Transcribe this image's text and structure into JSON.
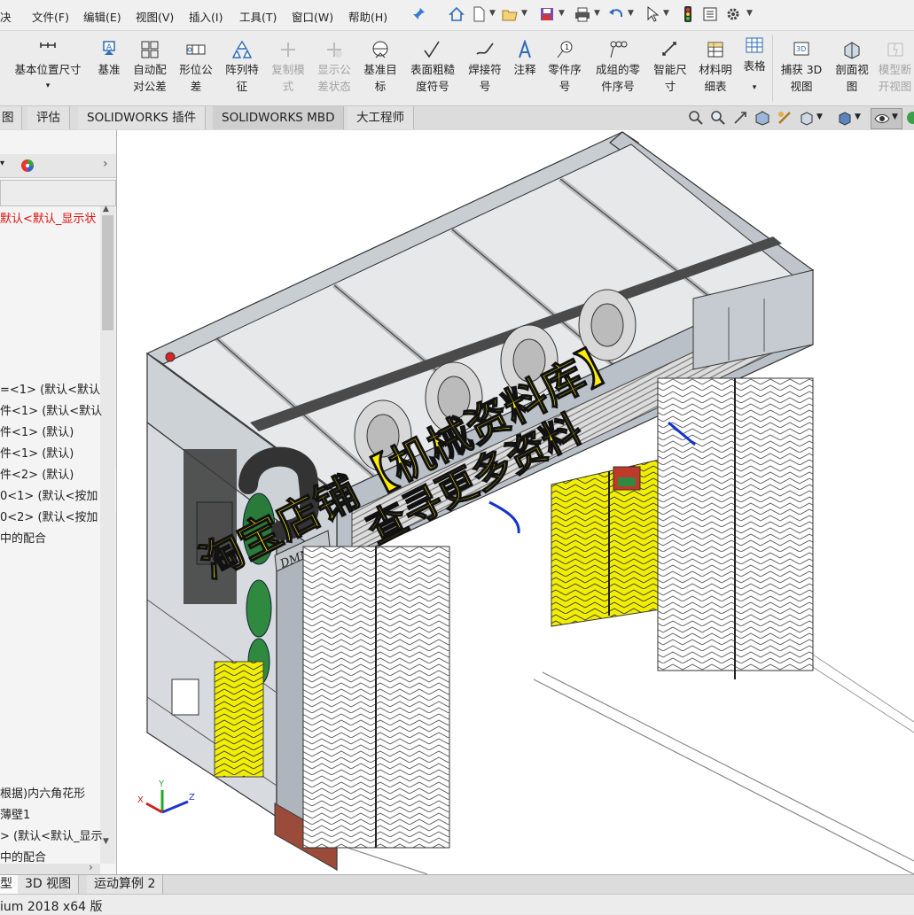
{
  "menu": {
    "items": [
      "文件(F)",
      "编辑(E)",
      "视图(V)",
      "插入(I)",
      "工具(T)",
      "窗口(W)",
      "帮助(H)"
    ],
    "left_cut": "决"
  },
  "ribbon": {
    "buttons": [
      {
        "label": "基本位置尺寸",
        "icon": "ordinate-dimension-icon"
      },
      {
        "label": "基准",
        "icon": "datum-icon"
      },
      {
        "label": "自动配\n对公差",
        "icon": "auto-tolerance-icon"
      },
      {
        "label": "形位公\n差",
        "icon": "geometric-tolerance-icon"
      },
      {
        "label": "阵列特\n征",
        "icon": "pattern-feature-icon"
      },
      {
        "label": "复制模\n式",
        "icon": "copy-scheme-icon",
        "disabled": true
      },
      {
        "label": "显示公\n差状态",
        "icon": "show-tolerance-status-icon",
        "disabled": true
      },
      {
        "label": "基准目\n标",
        "icon": "datum-target-icon"
      },
      {
        "label": "表面粗糙\n度符号",
        "icon": "surface-finish-icon"
      },
      {
        "label": "焊接符\n号",
        "icon": "weld-symbol-icon"
      },
      {
        "label": "注释",
        "icon": "note-icon"
      },
      {
        "label": "零件序\n号",
        "icon": "balloon-icon"
      },
      {
        "label": "成组的零\n件序号",
        "icon": "stacked-balloon-icon"
      },
      {
        "label": "智能尺\n寸",
        "icon": "smart-dimension-icon"
      },
      {
        "label": "材料明\n细表",
        "icon": "bom-icon"
      },
      {
        "label": "表格",
        "icon": "table-icon"
      },
      {
        "label": "捕获 3D\n视图",
        "icon": "capture-3d-view-icon"
      },
      {
        "label": "剖面视\n图",
        "icon": "section-view-icon"
      },
      {
        "label": "模型断\n开视图",
        "icon": "broken-view-icon",
        "disabled": true
      }
    ]
  },
  "tabs": {
    "items": [
      "图",
      "评估",
      "SOLIDWORKS 插件",
      "SOLIDWORKS MBD",
      "大工程师"
    ],
    "active": 3
  },
  "tree": {
    "lines": [
      {
        "text": "默认<默认_显示状",
        "red": true
      },
      {
        "text": "=<1> (默认<默认",
        "red": false
      },
      {
        "text": "件<1> (默认<默认",
        "red": false
      },
      {
        "text": "件<1> (默认)",
        "red": false
      },
      {
        "text": "件<1> (默认)",
        "red": false
      },
      {
        "text": "件<2> (默认)",
        "red": false
      },
      {
        "text": "0<1> (默认<按加",
        "red": false
      },
      {
        "text": "0<2> (默认<按加",
        "red": false
      },
      {
        "text": " 中的配合",
        "red": false
      },
      {
        "text": "根据)内六角花形",
        "red": false
      },
      {
        "text": "薄壁1",
        "red": false
      },
      {
        "text": "> (默认<默认_显示",
        "red": false
      },
      {
        "text": " 中的配合",
        "red": false
      }
    ]
  },
  "watermark": {
    "line1": "淘宝店铺【机械资料库】",
    "line2": "查寻更多资料"
  },
  "model": {
    "logo_text": "DMM"
  },
  "triad": {
    "x": "X",
    "y": "Y",
    "z": "Z"
  },
  "bottom_tabs": {
    "items": [
      "型",
      "3D 视图",
      "运动算例 2"
    ],
    "active": 0
  },
  "status": {
    "text": "ium 2018 x64 版"
  },
  "colors": {
    "frame": "#9aa3ab",
    "brush_yellow": "#f2ee00",
    "brush_white": "#ffffff",
    "roller_green": "#2a7a3a",
    "hose_blue": "#1133cc",
    "watermark": "#ffee00"
  }
}
